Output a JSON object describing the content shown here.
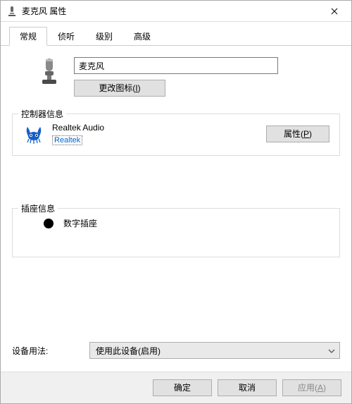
{
  "window": {
    "title": "麦克风 属性"
  },
  "tabs": {
    "general": "常规",
    "listen": "侦听",
    "levels": "级别",
    "advanced": "高级"
  },
  "device": {
    "name_value": "麦克风",
    "change_icon_label_pre": "更改图标(",
    "change_icon_hotkey": "I",
    "change_icon_label_post": ")"
  },
  "controller": {
    "legend": "控制器信息",
    "name": "Realtek Audio",
    "link": "Realtek",
    "properties_label_pre": "属性(",
    "properties_hotkey": "P",
    "properties_label_post": ")"
  },
  "jack": {
    "legend": "插座信息",
    "label": "数字插座"
  },
  "usage": {
    "label": "设备用法:",
    "selected": "使用此设备(启用)"
  },
  "footer": {
    "ok": "确定",
    "cancel": "取消",
    "apply_pre": "应用(",
    "apply_hotkey": "A",
    "apply_post": ")"
  }
}
